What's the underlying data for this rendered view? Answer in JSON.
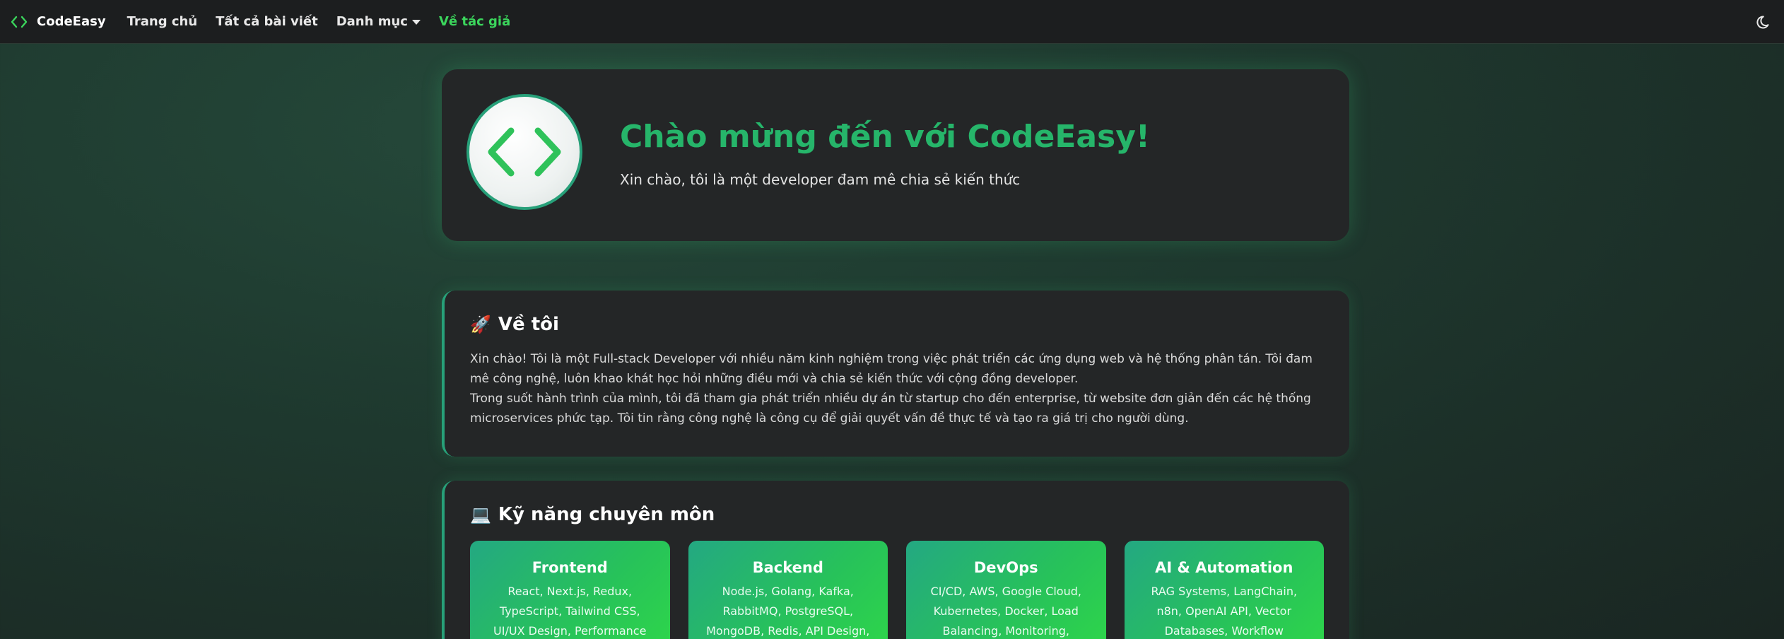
{
  "navbar": {
    "brand_name": "CodeEasy",
    "items": [
      {
        "label": "Trang chủ"
      },
      {
        "label": "Tất cả bài viết"
      },
      {
        "label": "Danh mục"
      },
      {
        "label": "Về tác giả"
      }
    ],
    "active_item": "Về tác giả",
    "theme_toggle_icon": "moon-icon"
  },
  "hero": {
    "avatar_icon": "code-brackets-icon",
    "title": "Chào mừng đến với CodeEasy!",
    "subtitle": "Xin chào, tôi là một developer đam mê chia sẻ kiến thức"
  },
  "about": {
    "icon": "🚀",
    "title": "Về tôi",
    "paragraphs": [
      "Xin chào! Tôi là một Full-stack Developer với nhiều năm kinh nghiệm trong việc phát triển các ứng dụng web và hệ thống phân tán. Tôi đam mê công nghệ, luôn khao khát học hỏi những điều mới và chia sẻ kiến thức với cộng đồng developer.",
      "Trong suốt hành trình của mình, tôi đã tham gia phát triển nhiều dự án từ startup cho đến enterprise, từ website đơn giản đến các hệ thống microservices phức tạp. Tôi tin rằng công nghệ là công cụ để giải quyết vấn đề thực tế và tạo ra giá trị cho người dùng."
    ]
  },
  "skills": {
    "icon": "💻",
    "title": "Kỹ năng chuyên môn",
    "cards": [
      {
        "title": "Frontend",
        "desc": "React, Next.js, Redux, TypeScript, Tailwind CSS, UI/UX Design, Performance"
      },
      {
        "title": "Backend",
        "desc": "Node.js, Golang, Kafka, RabbitMQ, PostgreSQL, MongoDB, Redis, API Design,"
      },
      {
        "title": "DevOps",
        "desc": "CI/CD, AWS, Google Cloud, Kubernetes, Docker, Load Balancing, Monitoring,"
      },
      {
        "title": "AI & Automation",
        "desc": "RAG Systems, LangChain, n8n, OpenAI API, Vector Databases, Workflow"
      }
    ]
  },
  "colors": {
    "accent_green": "#3bd65c",
    "title_green": "#26b56a",
    "card_bg": "#242627",
    "navbar_bg": "#1c1e1f"
  }
}
